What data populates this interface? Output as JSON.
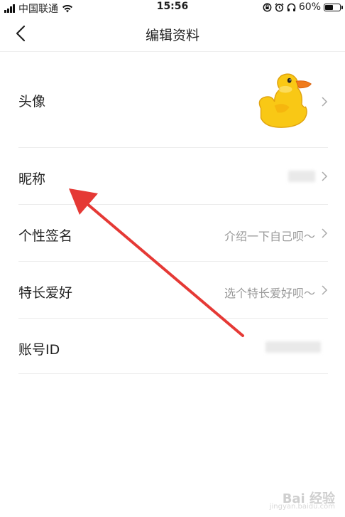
{
  "status_bar": {
    "carrier": "中国联通",
    "time": "15:56",
    "battery_percent": "60%",
    "battery_level": 0.6
  },
  "nav": {
    "back_icon": "chevron-left-icon",
    "title": "编辑资料"
  },
  "rows": {
    "avatar": {
      "label": "头像",
      "icon": "duck-avatar"
    },
    "nickname": {
      "label": "昵称"
    },
    "signature": {
      "label": "个性签名",
      "placeholder": "介绍一下自己呗～"
    },
    "hobby": {
      "label": "特长爱好",
      "placeholder": "选个特长爱好呗～"
    },
    "account_id": {
      "label": "账号ID"
    }
  },
  "colors": {
    "arrow": "#e53935",
    "duck": "#f9c815",
    "beak": "#f07b1c"
  },
  "watermark": {
    "brand": "Bai 经验",
    "url": "jingyan.baidu.com"
  }
}
